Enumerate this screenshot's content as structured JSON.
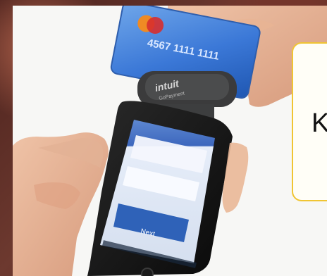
{
  "image": {
    "subject": "card reader attached to a smartphone",
    "callout_text": "K",
    "reader_brand": "intuit",
    "reader_subtext": "GoPayment",
    "card_text": "4567 1111 1111",
    "phone_screen_button": "Next"
  }
}
